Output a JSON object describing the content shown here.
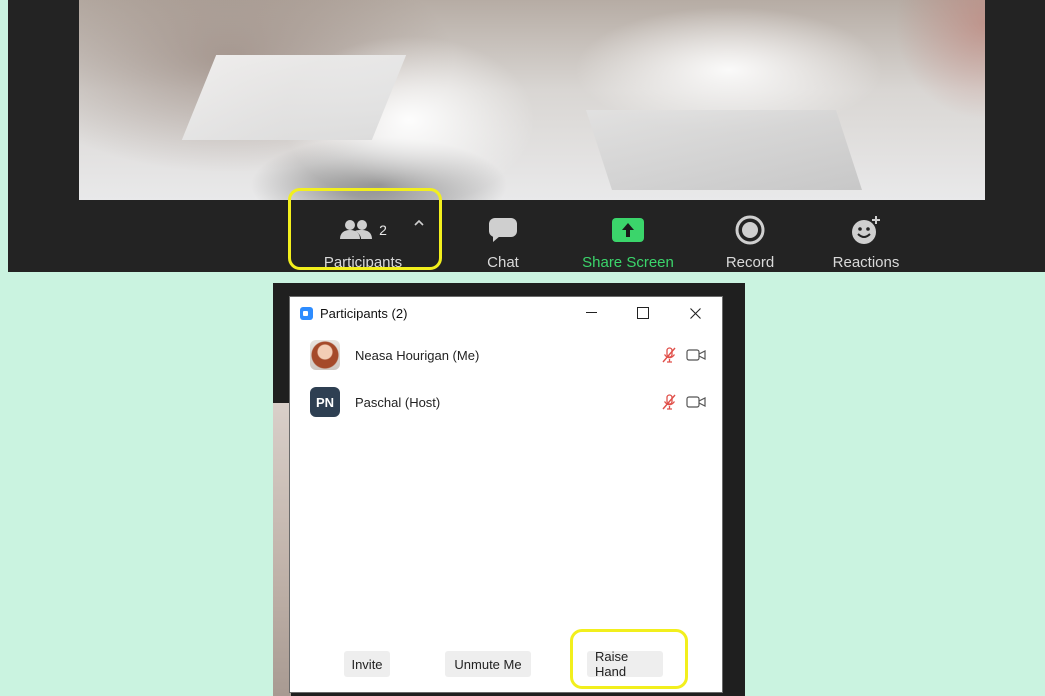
{
  "toolbar": {
    "participants_label": "Participants",
    "participants_count": "2",
    "chat_label": "Chat",
    "share_label": "Share Screen",
    "record_label": "Record",
    "reactions_label": "Reactions"
  },
  "participants_window": {
    "title": "Participants (2)",
    "participants": [
      {
        "name": "Neasa Hourigan (Me)",
        "avatar": "photo",
        "muted": true
      },
      {
        "name": "Paschal (Host)",
        "avatar_initials": "PN",
        "muted": true
      }
    ],
    "buttons": {
      "invite": "Invite",
      "unmute": "Unmute Me",
      "raise_hand": "Raise Hand"
    }
  },
  "colors": {
    "page_background": "#caf3e0",
    "toolbar_background": "#232323",
    "share_screen_green": "#3bd56b",
    "highlight_yellow": "#f2ef1d",
    "muted_red": "#e0504a",
    "avatar_initials_bg": "#2e3f52",
    "app_icon_blue": "#2d8cff"
  }
}
